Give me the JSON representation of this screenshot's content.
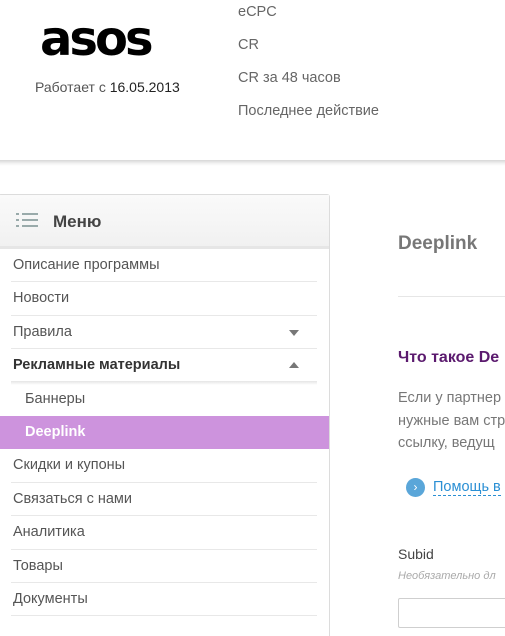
{
  "header": {
    "logo_text": "asos",
    "works_since_label": "Работает с",
    "works_since_date": "16.05.2013",
    "stats": [
      "eCPC",
      "CR",
      "CR за 48 часов",
      "Последнее действие"
    ]
  },
  "sidebar": {
    "title": "Меню",
    "items": [
      {
        "label": "Описание программы"
      },
      {
        "label": "Новости"
      },
      {
        "label": "Правила"
      },
      {
        "label": "Рекламные материалы"
      },
      {
        "label": "Баннеры"
      },
      {
        "label": "Deeplink"
      },
      {
        "label": "Скидки и купоны"
      },
      {
        "label": "Связаться с нами"
      },
      {
        "label": "Аналитика"
      },
      {
        "label": "Товары"
      },
      {
        "label": "Документы"
      }
    ]
  },
  "main": {
    "title": "Deeplink",
    "section_title": "Что такое De",
    "paragraph_lines": [
      "Если у партнер",
      "нужные вам стр",
      "ссылку, ведущ"
    ],
    "help_link": "Помощь в",
    "subid_label": "Subid",
    "subid_hint": "Необязательно дл",
    "subid_value": ""
  },
  "colors": {
    "active_item_bg": "#cd93dd",
    "section_title": "#5b1a6e",
    "link": "#2a8fd4"
  }
}
